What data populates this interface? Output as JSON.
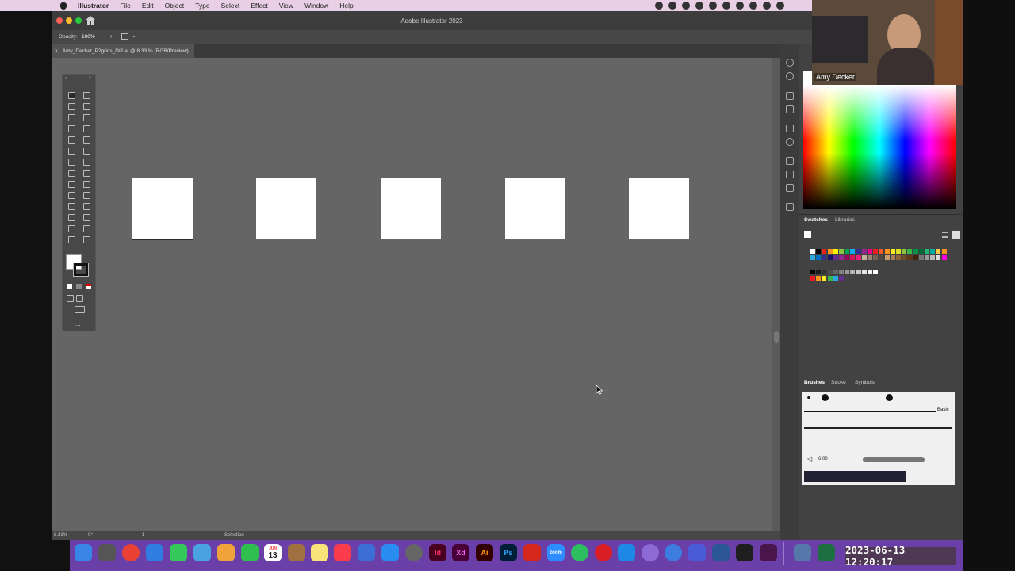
{
  "menubar": {
    "app_name": "Illustrator",
    "items": [
      "File",
      "Edit",
      "Object",
      "Type",
      "Select",
      "Effect",
      "View",
      "Window",
      "Help"
    ]
  },
  "window": {
    "title": "Adobe Illustrator 2023"
  },
  "control_bar": {
    "opacity_label": "Opacity:",
    "opacity_value": "100%"
  },
  "document_tab": {
    "close": "×",
    "label": "Amy_Decker_P2grids_DI2.ai @ 8.33 % (RGB/Preview)"
  },
  "artboards_count_visible": 5,
  "status_bar": {
    "zoom": "8.33%",
    "rotation": "0°",
    "artboard_number": "1",
    "tool_name": "Selection"
  },
  "panels": {
    "swatches_tabs": [
      "Swatches",
      "Libraries"
    ],
    "brushes_tabs": [
      "Brushes",
      "Stroke",
      "Symbols"
    ],
    "brush_basic_label": "Basic",
    "brush_size_value": "6.00",
    "more_tools": "..."
  },
  "video": {
    "participant_name": "Amy Decker"
  },
  "dock": {
    "calendar_month": "JUN",
    "calendar_day": "13",
    "indesign": "Id",
    "xd": "Xd",
    "illustrator": "Ai",
    "photoshop": "Ps",
    "zoom": "zoom"
  },
  "timestamp": "2023-06-13  12:20:17",
  "colors": {
    "canvas": "#656565",
    "ui_dark": "#3d3d3d",
    "panel": "#424242",
    "menubar": "#e9cfe6",
    "dock": "#6a3fa8"
  }
}
